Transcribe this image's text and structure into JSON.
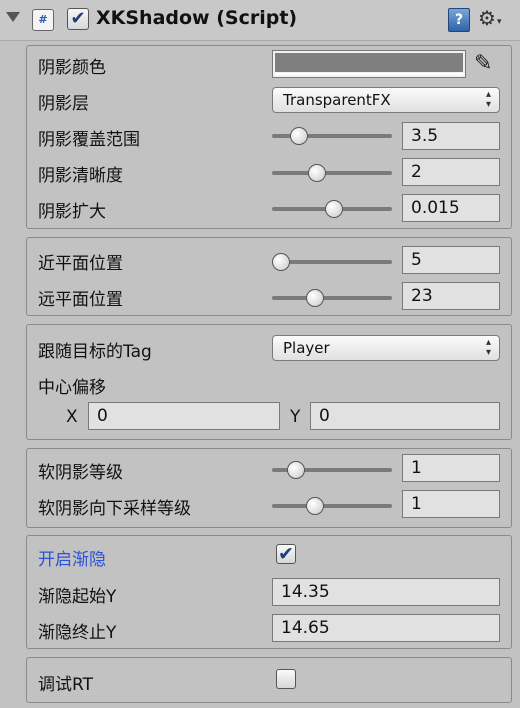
{
  "header": {
    "title": "XKShadow (Script)",
    "script_icon_glyph": "#",
    "enabled": true,
    "help_glyph": "?",
    "settings_glyph": "⚙",
    "settings_caret": "▾",
    "fold_icon": "triangle-down"
  },
  "shadow": {
    "color_label": "阴影颜色",
    "color_value": "#7f7f7f",
    "layer_label": "阴影层",
    "layer_value": "TransparentFX",
    "coverage_label": "阴影覆盖范围",
    "coverage_value": "3.5",
    "sharpness_label": "阴影清晰度",
    "sharpness_value": "2",
    "expand_label": "阴影扩大",
    "expand_value": "0.015"
  },
  "planes": {
    "near_label": "近平面位置",
    "near_value": "5",
    "far_label": "远平面位置",
    "far_value": "23"
  },
  "target": {
    "tag_label": "跟随目标的Tag",
    "tag_value": "Player",
    "offset_label": "中心偏移",
    "x_label": "X",
    "x_value": "0",
    "y_label": "Y",
    "y_value": "0"
  },
  "soft": {
    "level_label": "软阴影等级",
    "level_value": "1",
    "downsample_label": "软阴影向下采样等级",
    "downsample_value": "1"
  },
  "fade": {
    "enable_label": "开启渐隐",
    "enabled": true,
    "start_label": "渐隐起始Y",
    "start_value": "14.35",
    "end_label": "渐隐终止Y",
    "end_value": "14.65"
  },
  "debug": {
    "rt_label": "调试RT",
    "rt_enabled": false
  },
  "sliders": {
    "coverage": 0.18,
    "sharpness": 0.35,
    "expand": 0.52,
    "near": 0.0,
    "far": 0.33,
    "soft_level": 0.15,
    "soft_downsample": 0.33
  },
  "colors": {
    "accent_label": "#2a52d8",
    "check_mark": "#1e3f7e"
  }
}
